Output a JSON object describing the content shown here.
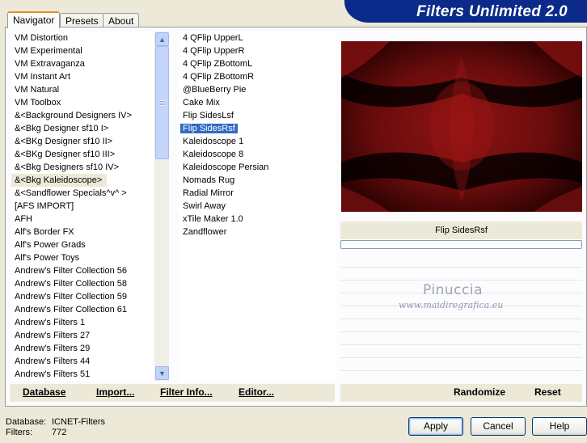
{
  "app": {
    "title": "Filters Unlimited 2.0"
  },
  "tabs": [
    {
      "label": "Navigator",
      "active": true
    },
    {
      "label": "Presets",
      "active": false
    },
    {
      "label": "About",
      "active": false
    }
  ],
  "categories": {
    "items": [
      "VM Distortion",
      "VM Experimental",
      "VM Extravaganza",
      "VM Instant Art",
      "VM Natural",
      "VM Toolbox",
      "&<Background Designers IV>",
      "&<Bkg Designer sf10 I>",
      "&<BKg Designer sf10 II>",
      "&<BKg Designer sf10 III>",
      "&<Bkg Designers sf10 IV>",
      "&<Bkg Kaleidoscope>",
      "&<Sandflower Specials^v^ >",
      "[AFS IMPORT]",
      "AFH",
      "Alf's Border FX",
      "Alf's Power Grads",
      "Alf's Power Toys",
      "Andrew's Filter Collection 56",
      "Andrew's Filter Collection 58",
      "Andrew's Filter Collection 59",
      "Andrew's Filter Collection 61",
      "Andrew's Filters 1",
      "Andrew's Filters 27",
      "Andrew's Filters 29",
      "Andrew's Filters 44",
      "Andrew's Filters 51"
    ],
    "selected_index": 11
  },
  "filters": {
    "items": [
      "4 QFlip UpperL",
      "4 QFlip UpperR",
      "4 QFlip ZBottomL",
      "4 QFlip ZBottomR",
      "@BlueBerry Pie",
      "Cake Mix",
      "Flip SidesLsf",
      "Flip SidesRsf",
      "Kaleidoscope 1",
      "Kaleidoscope 8",
      "Kaleidoscope Persian",
      "Nomads Rug",
      "Radial Mirror",
      "Swirl Away",
      "xTile Maker 1.0",
      "Zandflower"
    ],
    "selected_index": 7
  },
  "action_bar": {
    "database": "Database",
    "import": "Import...",
    "filter_info": "Filter Info...",
    "editor": "Editor...",
    "randomize": "Randomize",
    "reset": "Reset"
  },
  "preview": {
    "filter_name": "Flip SidesRsf",
    "progress": 0,
    "colors": {
      "dark": "#0a0000",
      "mid": "#7a1010",
      "light": "#a51818"
    }
  },
  "watermark": {
    "name": "Pinuccia",
    "url": "www.maidiregrafica.eu"
  },
  "footer": {
    "database_label": "Database:",
    "database_value": "ICNET-Filters",
    "filters_label": "Filters:",
    "filters_value": "772",
    "apply": "Apply",
    "cancel": "Cancel",
    "help": "Help"
  },
  "scrollbar": {
    "up": "up-arrow-icon",
    "down": "down-arrow-icon"
  }
}
